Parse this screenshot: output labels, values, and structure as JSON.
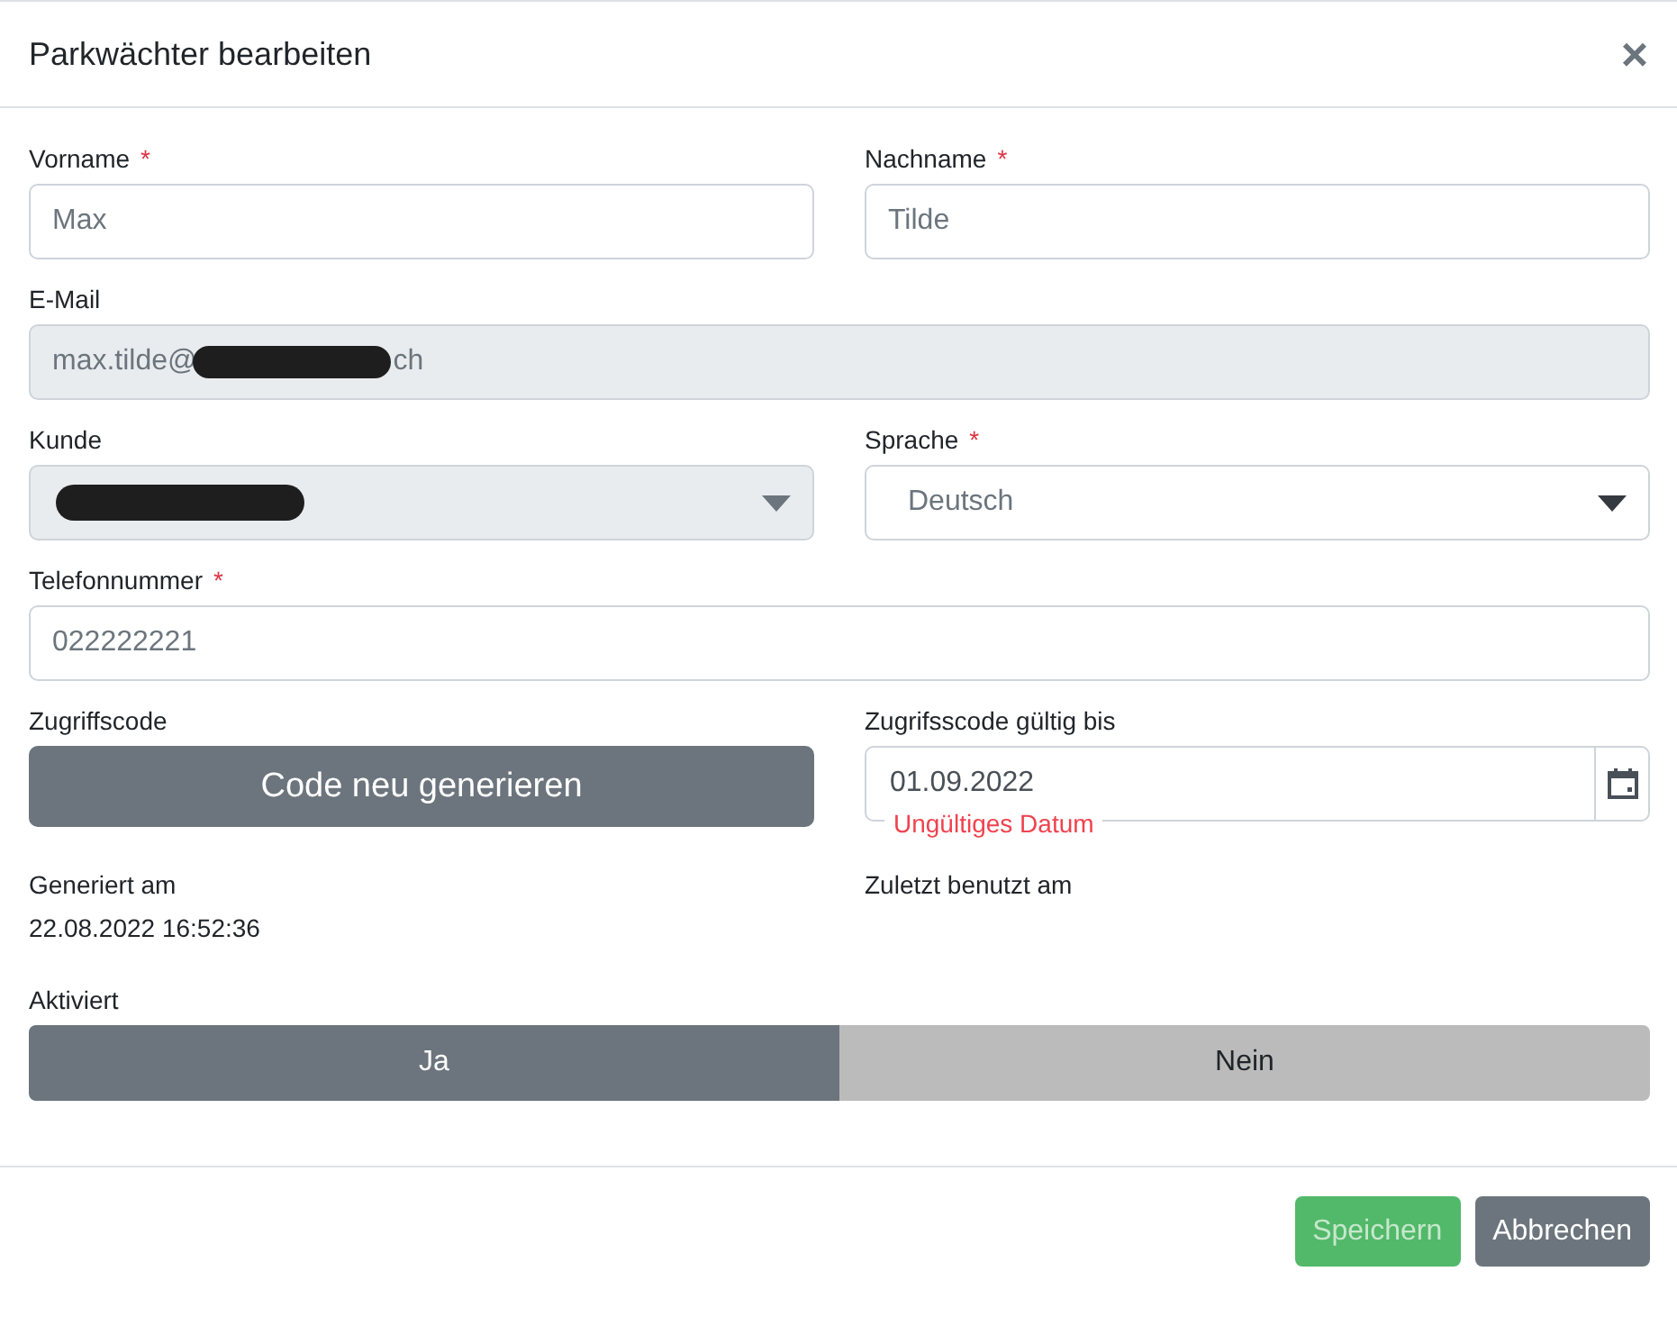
{
  "title": "Parkwächter bearbeiten",
  "close_glyph": "×",
  "first_name": {
    "label": "Vorname",
    "required_mark": "*",
    "value": "Max"
  },
  "last_name": {
    "label": "Nachname",
    "required_mark": "*",
    "value": "Tilde"
  },
  "email": {
    "label": "E-Mail",
    "disabled": true,
    "value_start": "max.tilde@",
    "value_end": "ch"
  },
  "customer": {
    "label": "Kunde",
    "disabled": true
  },
  "language": {
    "label": "Sprache",
    "required_mark": "*",
    "value": "Deutsch",
    "disabled": false
  },
  "phone": {
    "label": "Telefonnummer",
    "required_mark": "*",
    "value": "022222221"
  },
  "access_code": {
    "label": "Zugriffscode",
    "button": "Code neu generieren"
  },
  "valid_until": {
    "label": "Zugrifsscode gültig bis",
    "value": "01.09.2022",
    "error": "Ungültiges Datum"
  },
  "generated": {
    "label": "Generiert am",
    "value": "22.08.2022 16:52:36"
  },
  "last_used": {
    "label": "Zuletzt benutzt am"
  },
  "activated": {
    "label": "Aktiviert",
    "options": [
      {
        "label": "Ja",
        "selected": true
      },
      {
        "label": "Nein",
        "selected": false
      }
    ]
  },
  "footer": [
    {
      "label": "Speichern",
      "kind": "primary",
      "disabled": true
    },
    {
      "label": "Abbrechen",
      "kind": "secondary",
      "disabled": false
    }
  ]
}
